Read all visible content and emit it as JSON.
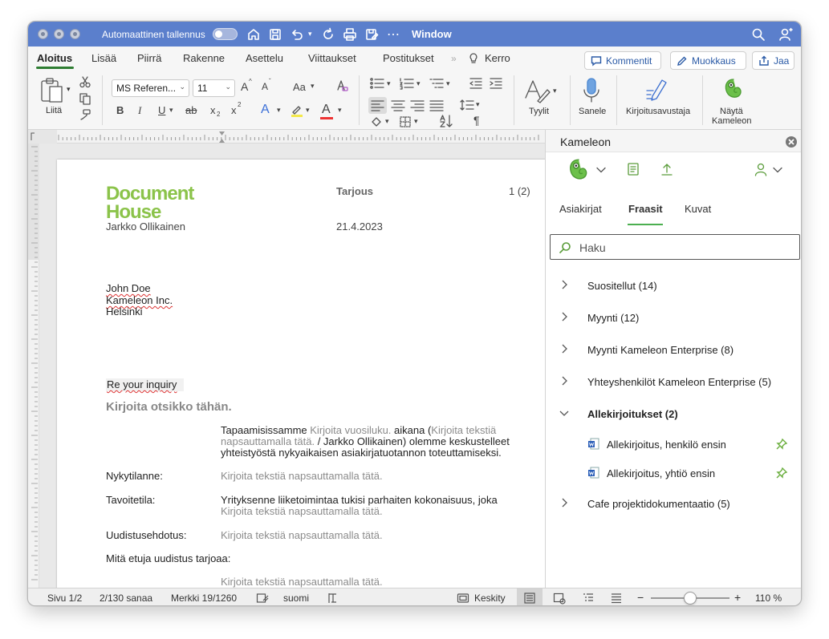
{
  "titlebar": {
    "autosave_label": "Automaattinen tallennus",
    "window_label": "Window"
  },
  "tabs": {
    "items": [
      {
        "label": "Aloitus",
        "active": true
      },
      {
        "label": "Lisää"
      },
      {
        "label": "Piirrä"
      },
      {
        "label": "Rakenne"
      },
      {
        "label": "Asettelu"
      },
      {
        "label": "Viittaukset"
      },
      {
        "label": "Postitukset"
      }
    ],
    "tell_label": "Kerro",
    "comments_label": "Kommentit",
    "edit_label": "Muokkaus",
    "share_label": "Jaa"
  },
  "ribbon": {
    "paste_label": "Liitä",
    "font_name": "MS Referen...",
    "font_size": "11",
    "styles_label": "Tyylit",
    "dictate_label": "Sanele",
    "editor_label": "Kirjoitusavustaja",
    "show_label_1": "Näytä",
    "show_label_2": "Kameleon",
    "bold": "B",
    "italic": "I",
    "underline": "U",
    "strike": "ab",
    "sub": "x",
    "sup": "x",
    "font_a": "A",
    "case_aa": "Aa",
    "grow": "A",
    "shrink": "A",
    "pilcrow": "¶"
  },
  "document": {
    "logo_line1": "Document",
    "logo_line2": "House",
    "author": "Jarkko Ollikainen",
    "doc_type": "Tarjous",
    "page_info": "1 (2)",
    "date": "21.4.2023",
    "recipient_name": "John Doe",
    "recipient_company": "Kameleon Inc.",
    "recipient_city": "Helsinki",
    "subject": "Re your inquiry",
    "heading": "Kirjoita otsikko tähän.",
    "intro_1a": "Tapaamisissamme ",
    "intro_1b": "Kirjoita vuosiluku.",
    "intro_1c": " aikana (",
    "intro_1d": "Kirjoita tekstiä",
    "intro_2a": "napsauttamalla tätä.",
    "intro_2b": " / Jarkko Ollikainen) olemme keskustelleet",
    "intro_3": "yhteistyöstä nykyaikaisen asiakirjatuotannon toteuttamiseksi.",
    "current_label": "Nykytilanne:",
    "current_value": "Kirjoita tekstiä napsauttamalla tätä.",
    "target_label": "Tavoitetila:",
    "target_value_1": "Yrityksenne liiketoimintaa tukisi parhaiten kokonaisuus, joka",
    "target_value_2": "Kirjoita tekstiä napsauttamalla tätä.",
    "proposal_label": "Uudistusehdotus:",
    "proposal_value": "Kirjoita tekstiä napsauttamalla tätä.",
    "benefits_label": "Mitä etuja uudistus tarjoaa:",
    "benefits_value": "Kirjoita tekstiä napsauttamalla tätä."
  },
  "panel": {
    "title": "Kameleon",
    "tabs": [
      {
        "label": "Asiakirjat"
      },
      {
        "label": "Fraasit",
        "active": true
      },
      {
        "label": "Kuvat"
      }
    ],
    "search_placeholder": "Haku",
    "items": [
      {
        "label": "Suositellut (14)"
      },
      {
        "label": "Myynti (12)"
      },
      {
        "label": "Myynti Kameleon Enterprise (8)"
      },
      {
        "label": "Yhteyshenkilöt Kameleon Enterprise (5)"
      },
      {
        "label": "Allekirjoitukset (2)",
        "expanded": true
      },
      {
        "label": "Cafe projektidokumentaatio (5)"
      }
    ],
    "subitems": [
      {
        "label": "Allekirjoitus, henkilö ensin"
      },
      {
        "label": "Allekirjoitus, yhtiö ensin"
      }
    ]
  },
  "status": {
    "page": "Sivu 1/2",
    "words": "2/130 sanaa",
    "chars": "Merkki 19/1260",
    "language": "suomi",
    "focus": "Keskity",
    "zoom": "110 %",
    "zoom_minus": "−",
    "zoom_plus": "+"
  },
  "colors": {
    "titlebar": "#5b7fcc",
    "accent_green": "#4caf50",
    "logo_green": "#8bc34a"
  }
}
